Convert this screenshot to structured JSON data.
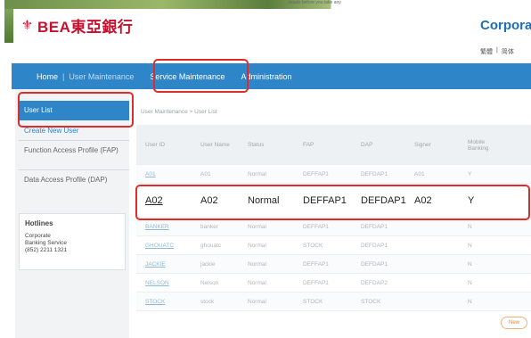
{
  "banner": {
    "note": "details before you take any"
  },
  "header": {
    "logo_mark": "⚜",
    "logo_text": "BEA東亞銀行",
    "corp_title": "Corpora",
    "lang_1": "繁體",
    "lang_sep": "|",
    "lang_2": "简体"
  },
  "nav": {
    "home": "Home",
    "sep": "|",
    "user_maintenance": "User Maintenance",
    "service_maintenance": "Service Maintenance",
    "administration": "Administration"
  },
  "sidebar": {
    "items": [
      {
        "label": "User List"
      },
      {
        "label": "Create New User"
      },
      {
        "label": "Function Access Profile (FAP)"
      },
      {
        "label": "Data Access Profile (DAP)"
      }
    ],
    "hotlines": {
      "title": "Hotlines",
      "line1": "Corporate",
      "line2": "Banking Service",
      "line3": "(852) 2211 1321"
    }
  },
  "main": {
    "breadcrumb": "User Maintenance > User List",
    "columns": [
      "User ID",
      "User Name",
      "Status",
      "FAP",
      "DAP",
      "Signer",
      "Mobile Banking"
    ],
    "rows": [
      [
        "A01",
        "A01",
        "Normal",
        "DEFFAP1",
        "DEFDAP1",
        "A01",
        "Y"
      ],
      [
        "A02",
        "A02",
        "Normal",
        "DEFFAP1",
        "DEFDAP1",
        "A02",
        "Y"
      ],
      [
        "BANKER",
        "banker",
        "Normal",
        "DEFFAP1",
        "DEFDAP1",
        "",
        "N"
      ],
      [
        "GHOUATC",
        "ghouatc",
        "Normal",
        "STOCK",
        "DEFDAP1",
        "",
        "N"
      ],
      [
        "JACKIE",
        "jackie",
        "Normal",
        "DEFFAP1",
        "DEFDAP1",
        "",
        "N"
      ],
      [
        "NELSON",
        "Nelson",
        "Normal",
        "DEFFAP1",
        "DEFDAP2",
        "",
        "N"
      ],
      [
        "STOCK",
        "stock",
        "Normal",
        "STOCK",
        "STOCK",
        "",
        "N"
      ]
    ],
    "new_button": "New"
  },
  "colors": {
    "brand_red": "#c8102e",
    "nav_blue": "#2e86c9",
    "highlight": "#e02b2b"
  }
}
